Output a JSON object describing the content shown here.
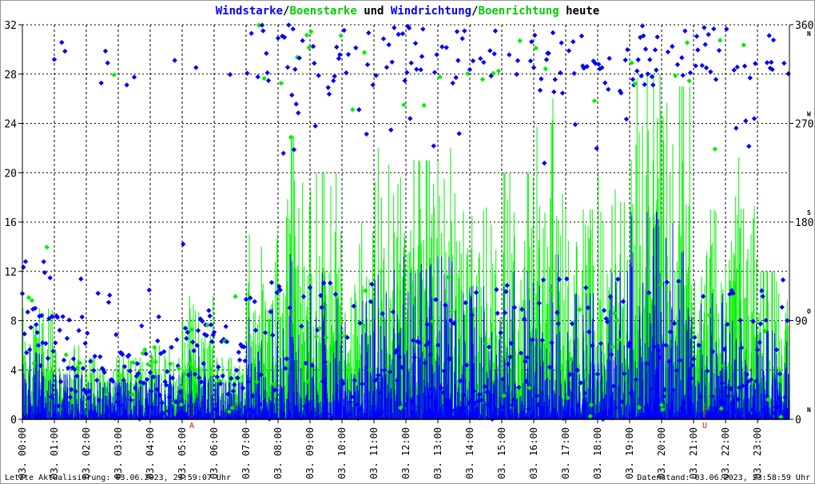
{
  "colors": {
    "wind": "#0000ff",
    "gust": "#00ee00",
    "grid": "#000000",
    "marker": "#ff0000",
    "text": "#000000"
  },
  "chart_data": {
    "type": "line",
    "title_parts": [
      {
        "text": "Windstarke",
        "color": "#0000ff"
      },
      {
        "text": "/",
        "color": "#000000"
      },
      {
        "text": "Boenstarke",
        "color": "#00cc00"
      },
      {
        "text": " und ",
        "color": "#000000"
      },
      {
        "text": "Windrichtung",
        "color": "#0000ff"
      },
      {
        "text": "/",
        "color": "#000000"
      },
      {
        "text": "Boenrichtung",
        "color": "#00cc00"
      },
      {
        "text": " heute",
        "color": "#000000"
      }
    ],
    "ylim": [
      0,
      32
    ],
    "y_ticks": [
      "0",
      "4",
      "8",
      "12",
      "16",
      "20",
      "24",
      "28",
      "32"
    ],
    "y2lim": [
      0,
      360
    ],
    "y2_ticks": [
      {
        "v": 0,
        "label": "0",
        "dir": "N"
      },
      {
        "v": 90,
        "label": "90",
        "dir": "O"
      },
      {
        "v": 180,
        "label": "180",
        "dir": "S"
      },
      {
        "v": 270,
        "label": "270",
        "dir": "W"
      },
      {
        "v": 360,
        "label": "360",
        "dir": "N"
      }
    ],
    "x_ticks": [
      "03. 00:00",
      "03. 01:00",
      "03. 02:00",
      "03. 03:00",
      "03. 04:00",
      "03. 05:00",
      "03. 06:00",
      "03. 07:00",
      "03. 08:00",
      "03. 09:00",
      "03. 10:00",
      "03. 11:00",
      "03. 12:00",
      "03. 13:00",
      "03. 14:00",
      "03. 15:00",
      "03. 16:00",
      "03. 17:00",
      "03. 18:00",
      "03. 19:00",
      "03. 20:00",
      "03. 21:00",
      "03. 22:00",
      "03. 23:00"
    ],
    "markers": [
      {
        "label": "A",
        "hour": 5.3
      },
      {
        "label": "U",
        "hour": 21.35
      }
    ],
    "hourly_mean_wind": [
      3,
      2,
      2,
      2,
      2,
      2,
      2,
      3,
      4,
      4,
      4,
      5,
      5,
      5,
      4,
      4,
      4,
      4,
      5,
      6,
      5,
      4,
      3,
      3
    ],
    "hourly_max_gust": [
      9,
      6,
      5,
      5,
      6,
      10,
      5,
      15,
      23,
      20,
      16,
      22,
      21,
      22,
      18,
      20,
      26,
      17,
      20,
      28,
      27,
      17,
      22,
      12
    ],
    "hourly_dominant_direction": [
      80,
      60,
      30,
      30,
      40,
      60,
      40,
      340,
      330,
      330,
      340,
      340,
      340,
      340,
      340,
      345,
      330,
      340,
      330,
      330,
      340,
      340,
      345,
      350
    ]
  },
  "footer": {
    "left": "Letzte Aktualisierung: 03.06.2023, 23:59:07 Uhr",
    "right": "Datenstand: 03.06.2023, 23:58:59 Uhr"
  }
}
